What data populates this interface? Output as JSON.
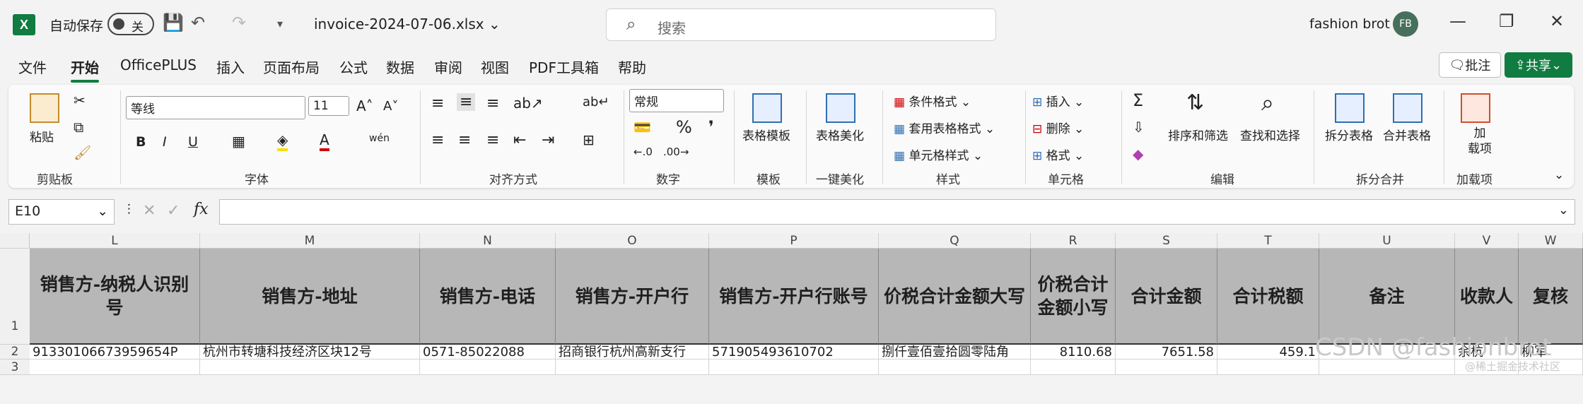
{
  "titlebar": {
    "autosave_label": "自动保存",
    "toggle_state": "关",
    "filename": "invoice-2024-07-06.xlsx",
    "search_placeholder": "搜索",
    "user_name": "fashion brot",
    "avatar_initials": "FB"
  },
  "menu": {
    "tabs": [
      "文件",
      "开始",
      "OfficePLUS",
      "插入",
      "页面布局",
      "公式",
      "数据",
      "审阅",
      "视图",
      "PDF工具箱",
      "帮助"
    ],
    "active_tab": "开始",
    "comment_label": "批注",
    "share_label": "共享"
  },
  "ribbon": {
    "paste_label": "粘贴",
    "font_name": "等线",
    "font_size": "11",
    "number_format": "常规",
    "table_template": "表格模板",
    "table_beautify": "表格美化",
    "conditional_format": "条件格式",
    "table_style": "套用表格格式",
    "cell_style": "单元格样式",
    "insert": "插入",
    "delete": "删除",
    "format": "格式",
    "sort_filter": "排序和筛选",
    "find_select": "查找和选择",
    "split_table": "拆分表格",
    "merge_table": "合并表格",
    "addin": "加\n载项",
    "groups": [
      "剪贴板",
      "字体",
      "对齐方式",
      "数字",
      "模板",
      "一键美化",
      "样式",
      "单元格",
      "编辑",
      "拆分合并",
      "加载项"
    ]
  },
  "formula_bar": {
    "name_box": "E10",
    "fx": "fx",
    "content": ""
  },
  "sheet": {
    "columns": [
      "L",
      "M",
      "N",
      "O",
      "P",
      "Q",
      "R",
      "S",
      "T",
      "U",
      "V",
      "W"
    ],
    "rows": [
      "1",
      "2",
      "3"
    ],
    "header_row": [
      "销售方-纳税人识别号",
      "销售方-地址",
      "销售方-电话",
      "销售方-开户行",
      "销售方-开户行账号",
      "价税合计金额大写",
      "价税合计金额小写",
      "合计金额",
      "合计税额",
      "备注",
      "收款人",
      "复核"
    ],
    "data_row": [
      "91330106673959654P",
      "杭州市转塘科技经济区块12号",
      "0571-85022088",
      "招商银行杭州高新支行",
      "571905493610702",
      "捌仟壹佰壹拾圆零陆角",
      "8110.68",
      "7651.58",
      "459.1",
      "",
      "余杭",
      "柳军"
    ]
  },
  "watermark": "CSDN @fashionbrot",
  "watermark_small": "@稀土掘金技术社区"
}
